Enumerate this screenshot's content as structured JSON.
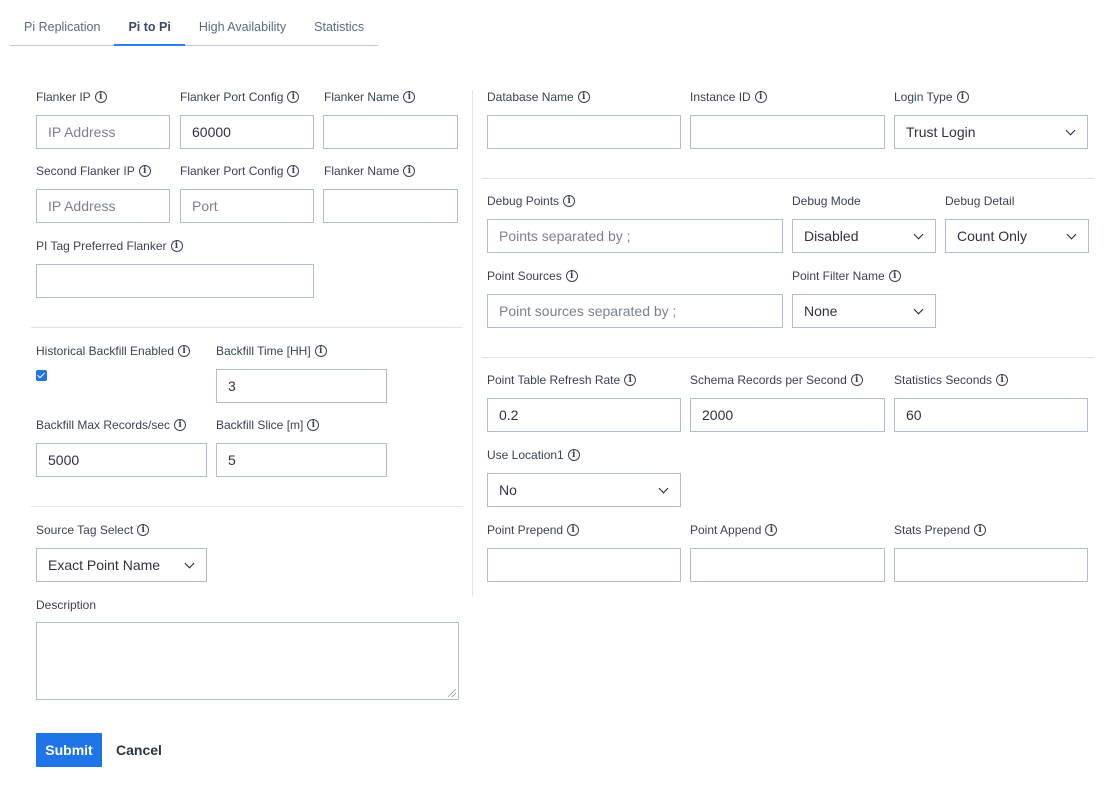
{
  "tabs": [
    {
      "label": "Pi Replication"
    },
    {
      "label": "Pi to Pi"
    },
    {
      "label": "High Availability"
    },
    {
      "label": "Statistics"
    }
  ],
  "left": {
    "flanker_ip": {
      "label": "Flanker IP",
      "placeholder": "IP Address",
      "value": ""
    },
    "flanker_port": {
      "label": "Flanker Port Config",
      "value": "60000"
    },
    "flanker_name": {
      "label": "Flanker Name",
      "value": ""
    },
    "second_flanker_ip": {
      "label": "Second Flanker IP",
      "placeholder": "IP Address",
      "value": ""
    },
    "second_flanker_port": {
      "label": "Flanker Port Config",
      "placeholder": "Port",
      "value": ""
    },
    "second_flanker_name": {
      "label": "Flanker Name",
      "value": ""
    },
    "pi_tag_preferred": {
      "label": "PI Tag Preferred Flanker",
      "value": ""
    },
    "historical_backfill": {
      "label": "Historical Backfill Enabled",
      "checked": true
    },
    "backfill_time": {
      "label": "Backfill Time [HH]",
      "value": "3"
    },
    "backfill_max_records": {
      "label": "Backfill Max Records/sec",
      "value": "5000"
    },
    "backfill_slice": {
      "label": "Backfill Slice [m]",
      "value": "5"
    },
    "source_tag_select": {
      "label": "Source Tag Select",
      "selected": "Exact Point Name"
    },
    "description": {
      "label": "Description",
      "value": ""
    }
  },
  "right": {
    "database_name": {
      "label": "Database Name",
      "value": ""
    },
    "instance_id": {
      "label": "Instance ID",
      "value": ""
    },
    "login_type": {
      "label": "Login Type",
      "selected": "Trust Login"
    },
    "debug_points": {
      "label": "Debug Points",
      "placeholder": "Points separated by ;",
      "value": ""
    },
    "debug_mode": {
      "label": "Debug Mode",
      "selected": "Disabled"
    },
    "debug_detail": {
      "label": "Debug Detail",
      "selected": "Count Only"
    },
    "point_sources": {
      "label": "Point Sources",
      "placeholder": "Point sources separated by ;",
      "value": ""
    },
    "point_filter_name": {
      "label": "Point Filter Name",
      "selected": "None"
    },
    "point_table_refresh": {
      "label": "Point Table Refresh Rate",
      "value": "0.2"
    },
    "schema_records": {
      "label": "Schema Records per Second",
      "value": "2000"
    },
    "statistics_seconds": {
      "label": "Statistics Seconds",
      "value": "60"
    },
    "use_location1": {
      "label": "Use Location1",
      "selected": "No"
    },
    "point_prepend": {
      "label": "Point Prepend",
      "value": ""
    },
    "point_append": {
      "label": "Point Append",
      "value": ""
    },
    "stats_prepend": {
      "label": "Stats Prepend",
      "value": ""
    }
  },
  "actions": {
    "submit": "Submit",
    "cancel": "Cancel"
  },
  "icons": {
    "info": "info-circle-icon",
    "dropdown": "chevron-down-icon",
    "check": "checkbox-checked-icon"
  },
  "colors": {
    "accent": "#1f75e8",
    "border": "#aebdd3",
    "text": "#3a4256"
  }
}
